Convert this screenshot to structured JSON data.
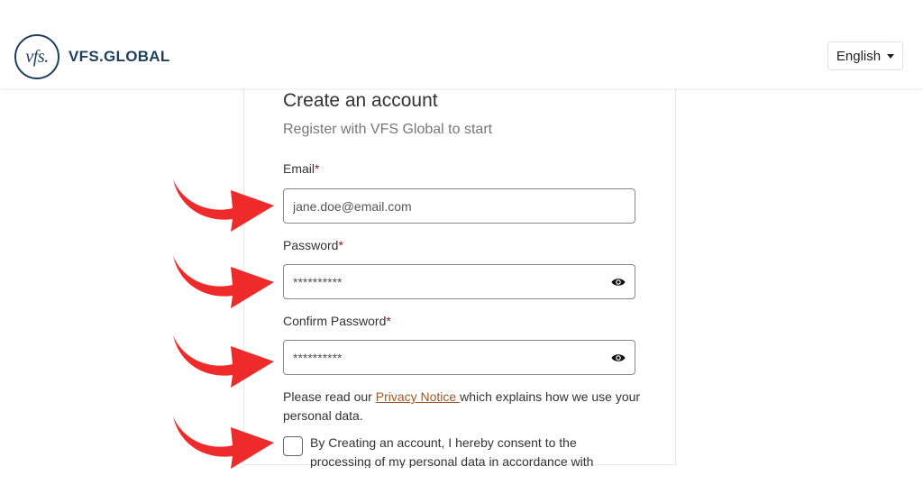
{
  "header": {
    "logo_text": "vfs.",
    "brand_name": "VFS.GLOBAL",
    "language": "English"
  },
  "form": {
    "title": "Create an account",
    "subtitle": "Register with VFS Global to start",
    "required_mark": "*",
    "email": {
      "label": "Email",
      "placeholder": "jane.doe@email.com"
    },
    "password": {
      "label": "Password",
      "value": "**********"
    },
    "confirm_password": {
      "label": "Confirm Password",
      "value": "**********"
    },
    "privacy": {
      "prefix": "Please read our ",
      "link": "Privacy Notice ",
      "suffix": "which explains how we use your personal data."
    },
    "consent_text": "By Creating an account, I hereby consent to the processing of my personal data in accordance with"
  },
  "colors": {
    "brand": "#1f3f5f",
    "annotation_arrow": "#ee2a2a",
    "required": "#8b1a1a",
    "link": "#9c5a2a"
  },
  "icons": {
    "password_toggle": "eye-icon",
    "dropdown": "caret-down-icon",
    "annotation": "curved-arrow-icon"
  }
}
